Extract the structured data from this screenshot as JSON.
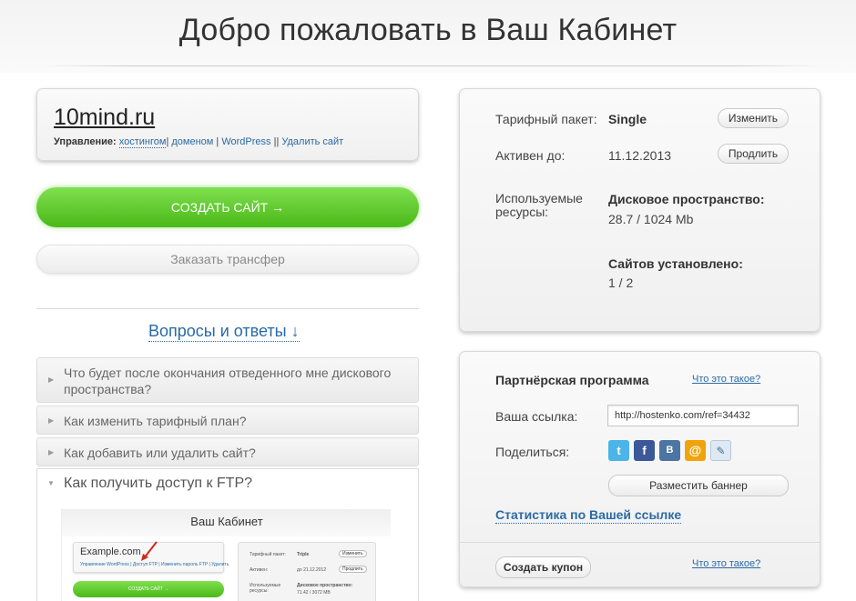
{
  "page": {
    "title": "Добро пожаловать в Ваш Кабинет"
  },
  "site": {
    "name": "10mind.ru",
    "management_label": "Управление:",
    "links": [
      "хостингом",
      "доменом",
      "WordPress",
      "Удалить сайт"
    ]
  },
  "actions": {
    "create_site": "СОЗДАТЬ САЙТ →",
    "order_transfer": "Заказать трансфер"
  },
  "faq": {
    "title": "Вопросы и ответы ↓",
    "items": [
      {
        "question": "Что будет после окончания отведенного мне дискового пространства?"
      },
      {
        "question": "Как изменить тарифный план?"
      },
      {
        "question": "Как добавить или удалить сайт?"
      },
      {
        "question": "Как получить доступ к FTP?"
      }
    ]
  },
  "faq_screenshot": {
    "title": "Ваш Кабинет",
    "site": "Example.com",
    "links": "Управление WordPress | Доступ FTP | Изменить пароль FTP | Удалить",
    "create_btn": "СОЗДАТЬ САЙТ →",
    "tariff_label": "Тарифный пакет:",
    "tariff_value": "Triple",
    "change": "Изменить",
    "active_label": "Активен:",
    "active_value": "до 21.12.2012",
    "extend": "Продлить",
    "resources_label": "Используемые ресурсы:",
    "disk_label": "Дисковое пространство:",
    "disk_value": "71.42 / 3072 MB"
  },
  "account": {
    "tariff_label": "Тарифный пакет:",
    "tariff_value": "Single",
    "change_button": "Изменить",
    "active_label": "Активен до:",
    "active_value": "11.12.2013",
    "extend_button": "Продлить",
    "resources_label": "Используемые ресурсы:",
    "disk_label": "Дисковое пространство:",
    "disk_value": "28.7 / 1024 Mb",
    "sites_label": "Сайтов установлено:",
    "sites_value": "1 / 2"
  },
  "partner": {
    "title": "Партнёрская программа",
    "what_is_it": "Что это такое?",
    "link_label": "Ваша ссылка:",
    "link_value": "http://hostenko.com/ref=34432",
    "share_label": "Поделиться:",
    "share_icons": [
      "twitter-icon",
      "facebook-icon",
      "vk-icon",
      "mail-icon",
      "livejournal-icon"
    ],
    "banner_button": "Разместить баннер",
    "stats_link": "Статистика по Вашей ссылке",
    "coupon_button": "Создать купон",
    "coupon_what": "Что это такое?"
  }
}
